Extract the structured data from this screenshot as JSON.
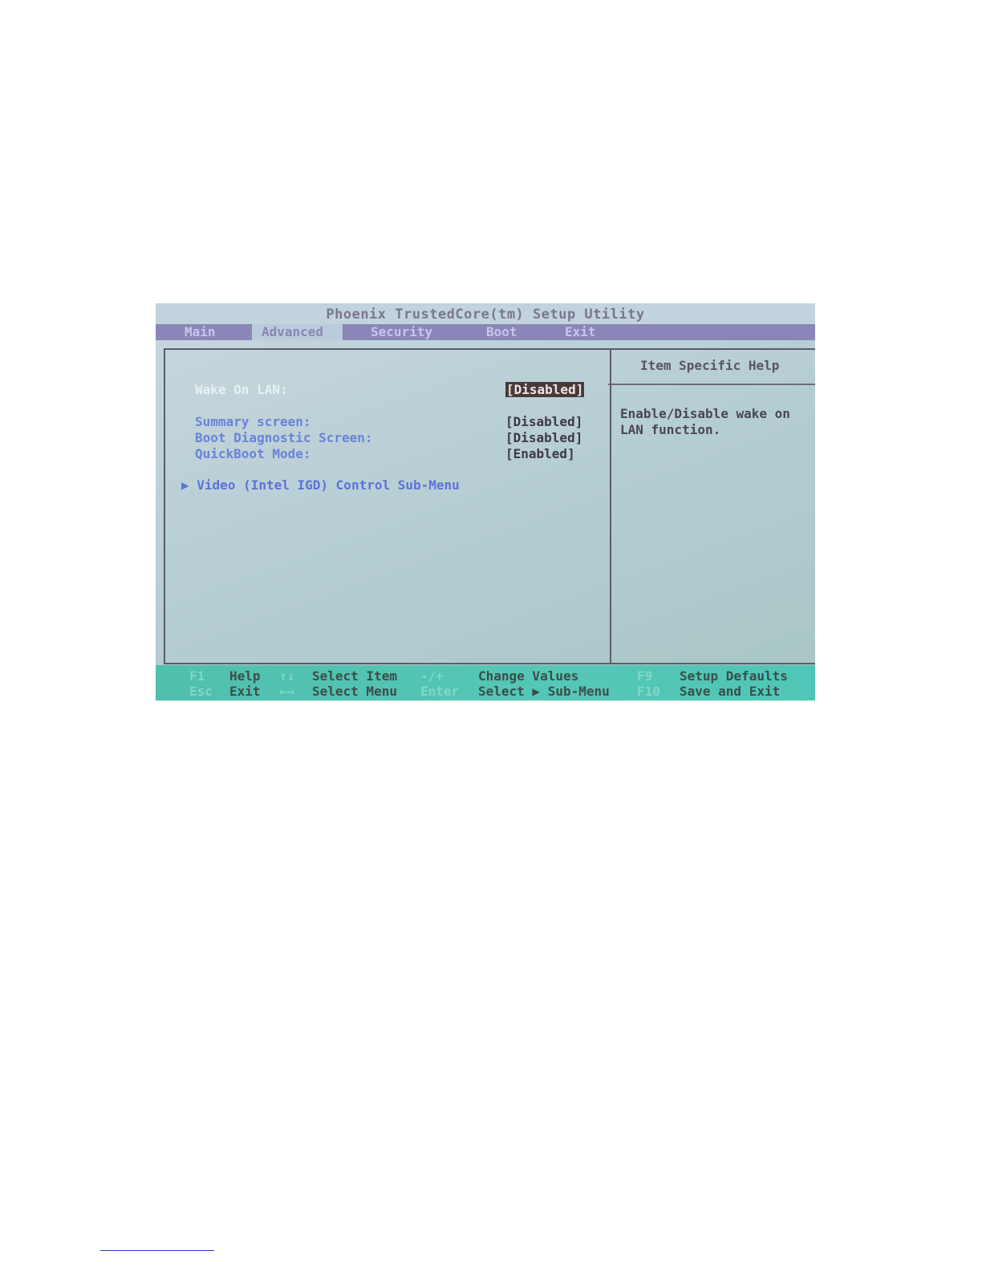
{
  "title": "Phoenix TrustedCore(tm) Setup Utility",
  "menu": [
    {
      "label": "Main"
    },
    {
      "label": "Advanced"
    },
    {
      "label": "Security"
    },
    {
      "label": "Boot"
    },
    {
      "label": "Exit"
    }
  ],
  "settings": [
    {
      "label": "Wake On LAN:",
      "value": "[Disabled]"
    },
    {
      "label": "Summary screen:",
      "value": "[Disabled]"
    },
    {
      "label": "Boot Diagnostic Screen:",
      "value": "[Disabled]"
    },
    {
      "label": "QuickBoot Mode:",
      "value": "[Enabled]"
    }
  ],
  "submenu": {
    "arrow": "▶",
    "label": "Video (Intel IGD) Control Sub-Menu"
  },
  "help": {
    "title": "Item Specific Help",
    "text": "Enable/Disable wake on\nLAN function."
  },
  "footer": {
    "row1": [
      {
        "key": "F1",
        "desc": "Help"
      },
      {
        "key": "↑↓",
        "desc": "Select Item"
      },
      {
        "key": "-/+",
        "desc": "Change Values"
      },
      {
        "key": "F9",
        "desc": "Setup Defaults"
      }
    ],
    "row2": [
      {
        "key": "Esc",
        "desc": "Exit"
      },
      {
        "key": "←→",
        "desc": "Select Menu"
      },
      {
        "key": "Enter",
        "desc": "Select ▶ Sub-Menu"
      },
      {
        "key": "F10",
        "desc": "Save and Exit"
      }
    ]
  },
  "colors": {
    "menubar": "#8a86b8",
    "footer": "#4fbfae",
    "selected_value_bg": "#4a3a3a"
  }
}
